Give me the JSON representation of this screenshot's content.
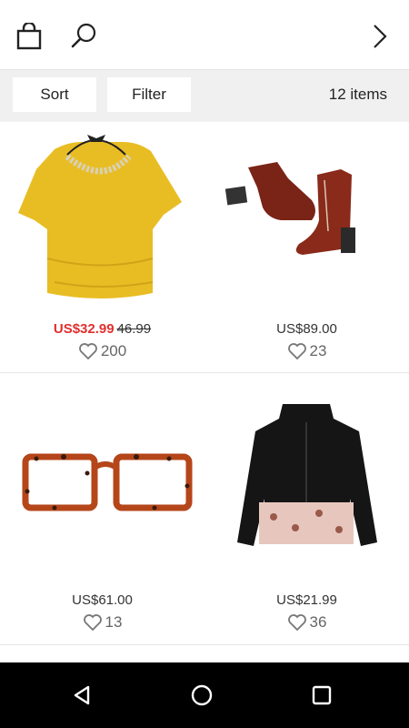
{
  "header": {
    "bag_icon": "shopping-bag-icon",
    "search_icon": "search-icon",
    "next_icon": "chevron-right-icon"
  },
  "toolbar": {
    "sort_label": "Sort",
    "filter_label": "Filter",
    "items_count": "12 items"
  },
  "products": [
    {
      "name": "yellow-blouse-necklace",
      "sale_price": "US$32.99",
      "original_price": "46.99",
      "likes": "200"
    },
    {
      "name": "brown-ankle-boots",
      "price": "US$89.00",
      "likes": "23"
    },
    {
      "name": "leopard-glasses",
      "price": "US$61.00",
      "likes": "13"
    },
    {
      "name": "fur-jacket",
      "price": "US$21.99",
      "likes": "36"
    }
  ],
  "colors": {
    "sale": "#e0302e",
    "navbar": "#000000"
  },
  "navbar": {
    "back_icon": "back-triangle-icon",
    "home_icon": "home-circle-icon",
    "recents_icon": "recents-square-icon"
  }
}
